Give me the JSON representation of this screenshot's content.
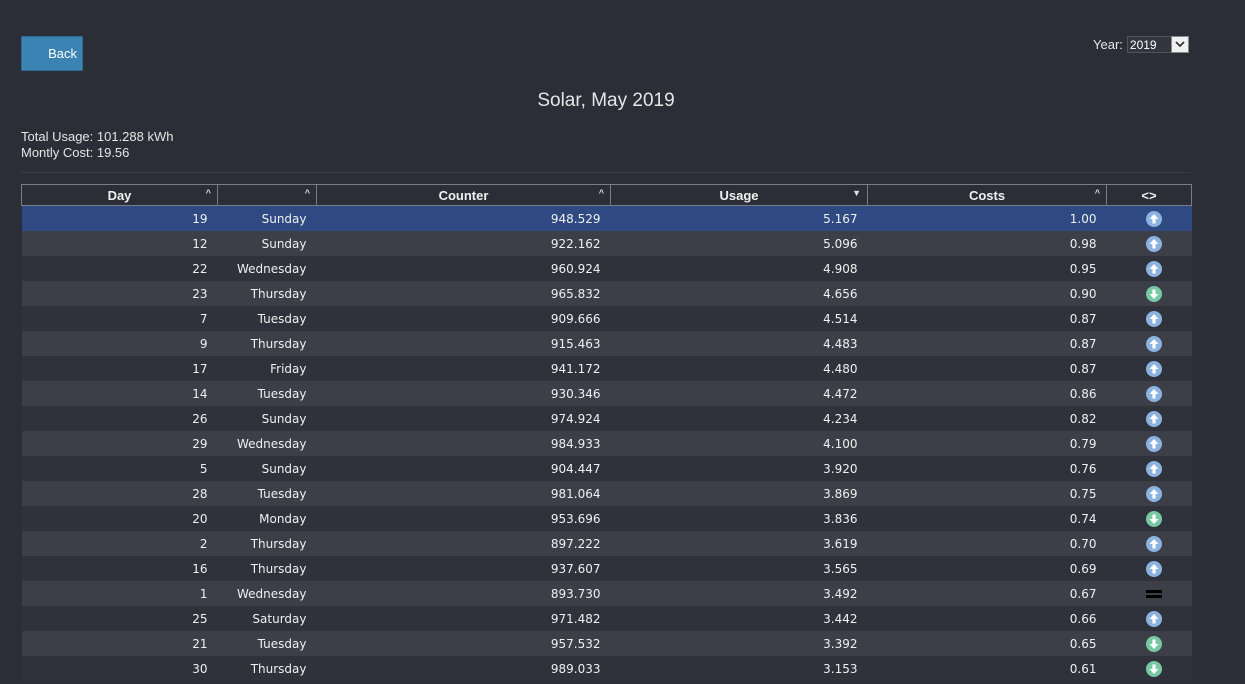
{
  "back_label": "Back",
  "year": {
    "label": "Year:",
    "selected": "2019"
  },
  "title": "Solar, May 2019",
  "summary": {
    "total_usage": "Total Usage: 101.288 kWh",
    "monthly_cost": "Montly Cost: 19.56"
  },
  "table": {
    "headers": [
      "Day",
      "",
      "Counter",
      "Usage",
      "Costs",
      "<>"
    ],
    "rows": [
      {
        "day": "19",
        "weekday": "Sunday",
        "counter": "948.529",
        "usage": "5.167",
        "costs": "1.00",
        "trend": "up",
        "selected": true
      },
      {
        "day": "12",
        "weekday": "Sunday",
        "counter": "922.162",
        "usage": "5.096",
        "costs": "0.98",
        "trend": "up"
      },
      {
        "day": "22",
        "weekday": "Wednesday",
        "counter": "960.924",
        "usage": "4.908",
        "costs": "0.95",
        "trend": "up"
      },
      {
        "day": "23",
        "weekday": "Thursday",
        "counter": "965.832",
        "usage": "4.656",
        "costs": "0.90",
        "trend": "down"
      },
      {
        "day": "7",
        "weekday": "Tuesday",
        "counter": "909.666",
        "usage": "4.514",
        "costs": "0.87",
        "trend": "up"
      },
      {
        "day": "9",
        "weekday": "Thursday",
        "counter": "915.463",
        "usage": "4.483",
        "costs": "0.87",
        "trend": "up"
      },
      {
        "day": "17",
        "weekday": "Friday",
        "counter": "941.172",
        "usage": "4.480",
        "costs": "0.87",
        "trend": "up"
      },
      {
        "day": "14",
        "weekday": "Tuesday",
        "counter": "930.346",
        "usage": "4.472",
        "costs": "0.86",
        "trend": "up"
      },
      {
        "day": "26",
        "weekday": "Sunday",
        "counter": "974.924",
        "usage": "4.234",
        "costs": "0.82",
        "trend": "up"
      },
      {
        "day": "29",
        "weekday": "Wednesday",
        "counter": "984.933",
        "usage": "4.100",
        "costs": "0.79",
        "trend": "up"
      },
      {
        "day": "5",
        "weekday": "Sunday",
        "counter": "904.447",
        "usage": "3.920",
        "costs": "0.76",
        "trend": "up"
      },
      {
        "day": "28",
        "weekday": "Tuesday",
        "counter": "981.064",
        "usage": "3.869",
        "costs": "0.75",
        "trend": "up"
      },
      {
        "day": "20",
        "weekday": "Monday",
        "counter": "953.696",
        "usage": "3.836",
        "costs": "0.74",
        "trend": "down"
      },
      {
        "day": "2",
        "weekday": "Thursday",
        "counter": "897.222",
        "usage": "3.619",
        "costs": "0.70",
        "trend": "up"
      },
      {
        "day": "16",
        "weekday": "Thursday",
        "counter": "937.607",
        "usage": "3.565",
        "costs": "0.69",
        "trend": "up"
      },
      {
        "day": "1",
        "weekday": "Wednesday",
        "counter": "893.730",
        "usage": "3.492",
        "costs": "0.67",
        "trend": "equal"
      },
      {
        "day": "25",
        "weekday": "Saturday",
        "counter": "971.482",
        "usage": "3.442",
        "costs": "0.66",
        "trend": "up"
      },
      {
        "day": "21",
        "weekday": "Tuesday",
        "counter": "957.532",
        "usage": "3.392",
        "costs": "0.65",
        "trend": "down"
      },
      {
        "day": "30",
        "weekday": "Thursday",
        "counter": "989.033",
        "usage": "3.153",
        "costs": "0.61",
        "trend": "down"
      }
    ]
  },
  "colors": {
    "background": "#2b2e36",
    "selected_row": "#2f4a82",
    "back_button": "#3a83b3",
    "trend_up": "#8cb3df",
    "trend_down": "#78c8a6"
  }
}
